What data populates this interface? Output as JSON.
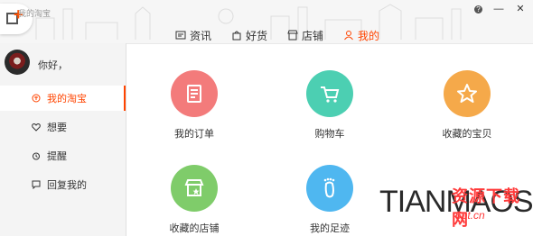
{
  "app": {
    "name": "我的淘宝"
  },
  "window_buttons": {
    "help": "?",
    "minimize": "—",
    "close": "✕"
  },
  "tabs": [
    {
      "label": "资讯",
      "icon": "news-icon"
    },
    {
      "label": "好货",
      "icon": "bag-icon"
    },
    {
      "label": "店铺",
      "icon": "shop-icon"
    },
    {
      "label": "我的",
      "icon": "user-icon",
      "active": true
    }
  ],
  "user": {
    "greeting": "你好，"
  },
  "sidebar": {
    "items": [
      {
        "label": "我的淘宝",
        "icon": "taobao-icon",
        "active": true
      },
      {
        "label": "想要",
        "icon": "heart-icon"
      },
      {
        "label": "提醒",
        "icon": "alarm-icon"
      },
      {
        "label": "回复我的",
        "icon": "message-icon"
      }
    ]
  },
  "grid": [
    {
      "label": "我的订单",
      "color": "#f37b7b",
      "icon": "order-icon"
    },
    {
      "label": "购物车",
      "color": "#4ccfb2",
      "icon": "cart-icon"
    },
    {
      "label": "收藏的宝贝",
      "color": "#f5a94a",
      "icon": "star-icon"
    },
    {
      "label": "收藏的店铺",
      "color": "#7fcc6a",
      "icon": "shop-star-icon"
    },
    {
      "label": "我的足迹",
      "color": "#4fb7f0",
      "icon": "footprint-icon"
    }
  ],
  "watermark": {
    "text": "TIANMAOS",
    "cn": "资源下载网",
    "site": "6pt.cn"
  },
  "colors": {
    "accent": "#ff4400"
  }
}
